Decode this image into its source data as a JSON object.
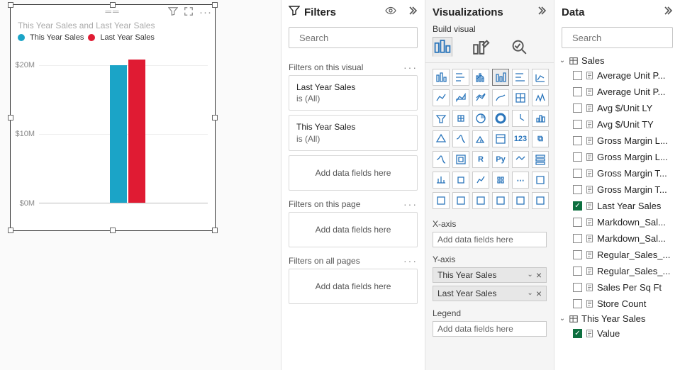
{
  "filters": {
    "title": "Filters",
    "search_placeholder": "Search",
    "sections": {
      "visual": {
        "label": "Filters on this visual",
        "cards": [
          {
            "title": "Last Year Sales",
            "sub": "is (All)"
          },
          {
            "title": "This Year Sales",
            "sub": "is (All)"
          }
        ]
      },
      "page": {
        "label": "Filters on this page"
      },
      "all": {
        "label": "Filters on all pages"
      }
    },
    "add_placeholder": "Add data fields here"
  },
  "viz": {
    "title": "Visualizations",
    "subtitle": "Build visual",
    "xaxis_label": "X-axis",
    "yaxis_label": "Y-axis",
    "legend_label": "Legend",
    "yaxis_fields": [
      "This Year Sales",
      "Last Year Sales"
    ],
    "add_placeholder": "Add data fields here"
  },
  "data": {
    "title": "Data",
    "search_placeholder": "Search",
    "tables": [
      {
        "name": "Sales",
        "expanded": true,
        "fields": [
          {
            "label": "Average Unit P...",
            "checked": false
          },
          {
            "label": "Average Unit P...",
            "checked": false
          },
          {
            "label": "Avg $/Unit LY",
            "checked": false
          },
          {
            "label": "Avg $/Unit TY",
            "checked": false
          },
          {
            "label": "Gross Margin L...",
            "checked": false
          },
          {
            "label": "Gross Margin L...",
            "checked": false
          },
          {
            "label": "Gross Margin T...",
            "checked": false
          },
          {
            "label": "Gross Margin T...",
            "checked": false
          },
          {
            "label": "Last Year Sales",
            "checked": true
          },
          {
            "label": "Markdown_Sal...",
            "checked": false
          },
          {
            "label": "Markdown_Sal...",
            "checked": false
          },
          {
            "label": "Regular_Sales_...",
            "checked": false
          },
          {
            "label": "Regular_Sales_...",
            "checked": false
          },
          {
            "label": "Sales Per Sq Ft",
            "checked": false
          },
          {
            "label": "Store Count",
            "checked": false
          }
        ]
      },
      {
        "name": "This Year Sales",
        "expanded": true,
        "fields": [
          {
            "label": "Value",
            "checked": true
          }
        ]
      }
    ]
  },
  "chart": {
    "title": "This Year Sales and Last Year Sales",
    "legend": [
      "This Year Sales",
      "Last Year Sales"
    ]
  },
  "chart_data": {
    "type": "bar",
    "title": "This Year Sales and Last Year Sales",
    "categories": [
      ""
    ],
    "series": [
      {
        "name": "This Year Sales",
        "color": "#1ba4c7",
        "values": [
          22000000
        ]
      },
      {
        "name": "Last Year Sales",
        "color": "#e01b33",
        "values": [
          23000000
        ]
      }
    ],
    "ylabel": "",
    "ylim": [
      0,
      25000000
    ],
    "yticks": [
      0,
      10000000,
      20000000
    ],
    "ytick_labels": [
      "$0M",
      "$10M",
      "$20M"
    ]
  }
}
